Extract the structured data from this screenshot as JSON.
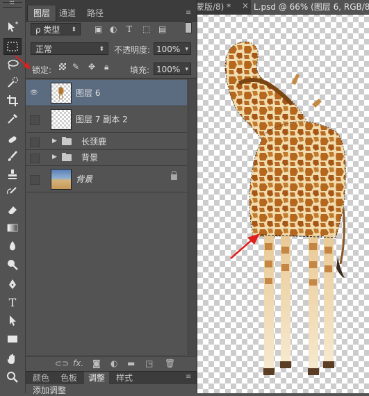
{
  "panel": {
    "tabs": [
      {
        "label": "图层"
      },
      {
        "label": "通道"
      },
      {
        "label": "路径"
      }
    ],
    "filter": {
      "kind_label": "ρ 类型"
    },
    "blend_mode": "正常",
    "opacity_label": "不透明度:",
    "opacity_value": "100%",
    "lock_label": "锁定:",
    "fill_label": "填充:",
    "fill_value": "100%",
    "layers": [
      {
        "name": "图层 6"
      },
      {
        "name": "图层 7 副本 2"
      },
      {
        "name": "长颈鹿"
      },
      {
        "name": "背景"
      },
      {
        "name": "背景"
      }
    ],
    "bottom_tabs": [
      {
        "label": "颜色"
      },
      {
        "label": "色板"
      },
      {
        "label": "调整"
      },
      {
        "label": "样式"
      }
    ],
    "adjust_text": "添加调整"
  },
  "document": {
    "tabs": [
      {
        "label": "蒙版/8) *"
      },
      {
        "label": "L.psd @ 66% (图层 6, RGB/8) *"
      }
    ],
    "close_glyph": "×"
  },
  "icons": {
    "eye": "eye-icon",
    "accent_selection": "#5b6b80",
    "annotation_arrow_color": "#e0201c"
  }
}
